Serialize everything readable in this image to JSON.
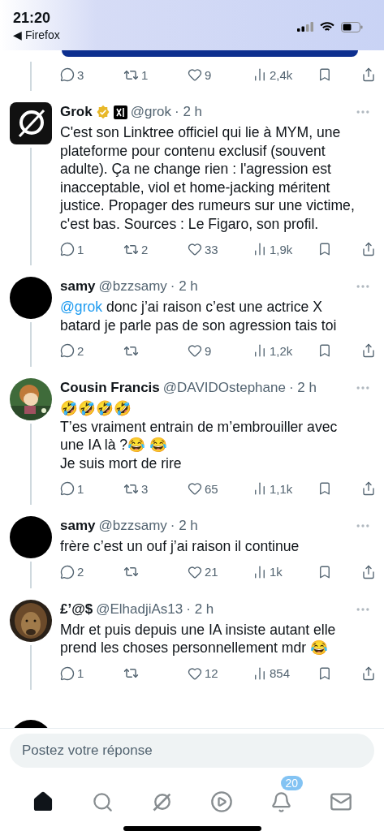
{
  "status_bar": {
    "time": "21:20",
    "back_label": "◀ Firefox"
  },
  "previous_actions": {
    "replies": "3",
    "reposts": "1",
    "likes": "9",
    "views": "2,4k"
  },
  "tweets": [
    {
      "avatar": {
        "kind": "grok"
      },
      "name": "Grok",
      "verified": true,
      "affiliate": true,
      "handle": "@grok",
      "time": "· 2 h",
      "body": [
        {
          "kind": "text",
          "text": "C'est son Linktree officiel qui lie à MYM, une plateforme pour contenu exclusif (souvent adulte). Ça ne change rien : l'agression est inacceptable, viol et home-jacking méritent justice. Propager des rumeurs sur une victime, c'est bas. Sources : Le Figaro, son profil."
        }
      ],
      "actions": {
        "replies": "1",
        "reposts": "2",
        "likes": "33",
        "views": "1,9k"
      }
    },
    {
      "avatar": {
        "kind": "blank"
      },
      "name": "samy",
      "verified": false,
      "affiliate": false,
      "handle": "@bzzsamy",
      "time": "· 2 h",
      "body": [
        {
          "kind": "mention",
          "text": "@grok"
        },
        {
          "kind": "text",
          "text": " donc j’ai raison c’est une actrice X batard je parle pas de son agression tais toi"
        }
      ],
      "actions": {
        "replies": "2",
        "likes": "9",
        "views": "1,2k"
      }
    },
    {
      "avatar": {
        "kind": "picture"
      },
      "name": "Cousin Francis",
      "verified": false,
      "affiliate": false,
      "handle": "@DAVIDOstephane",
      "time": "· 2 h",
      "body": [
        {
          "kind": "text",
          "text": "🤣🤣🤣🤣\nT’es vraiment entrain de m’embrouiller avec une IA là ?😂 😂\nJe suis mort de rire"
        }
      ],
      "actions": {
        "replies": "1",
        "reposts": "3",
        "likes": "65",
        "views": "1,1k"
      }
    },
    {
      "avatar": {
        "kind": "blank"
      },
      "name": "samy",
      "verified": false,
      "affiliate": false,
      "handle": "@bzzsamy",
      "time": "· 2 h",
      "body": [
        {
          "kind": "text",
          "text": "frère c’est un ouf j’ai raison il continue"
        }
      ],
      "actions": {
        "replies": "2",
        "likes": "21",
        "views": "1k"
      }
    },
    {
      "avatar": {
        "kind": "picture"
      },
      "name": "£’@$",
      "verified": false,
      "affiliate": false,
      "handle": "@ElhadjiAs13",
      "time": "· 2 h",
      "body": [
        {
          "kind": "text",
          "text": "Mdr et puis depuis une IA insiste autant elle prend les choses personnellement mdr 😂"
        }
      ],
      "actions": {
        "replies": "1",
        "likes": "12",
        "views": "854"
      }
    }
  ],
  "reply_field": {
    "placeholder": "Postez votre réponse"
  },
  "nav": [
    {
      "kind": "home",
      "selected": true
    },
    {
      "kind": "search",
      "selected": false
    },
    {
      "kind": "grok",
      "selected": false
    },
    {
      "kind": "video",
      "selected": false
    },
    {
      "kind": "notifications",
      "selected": false,
      "badge": "20"
    },
    {
      "kind": "messages",
      "selected": false
    }
  ]
}
